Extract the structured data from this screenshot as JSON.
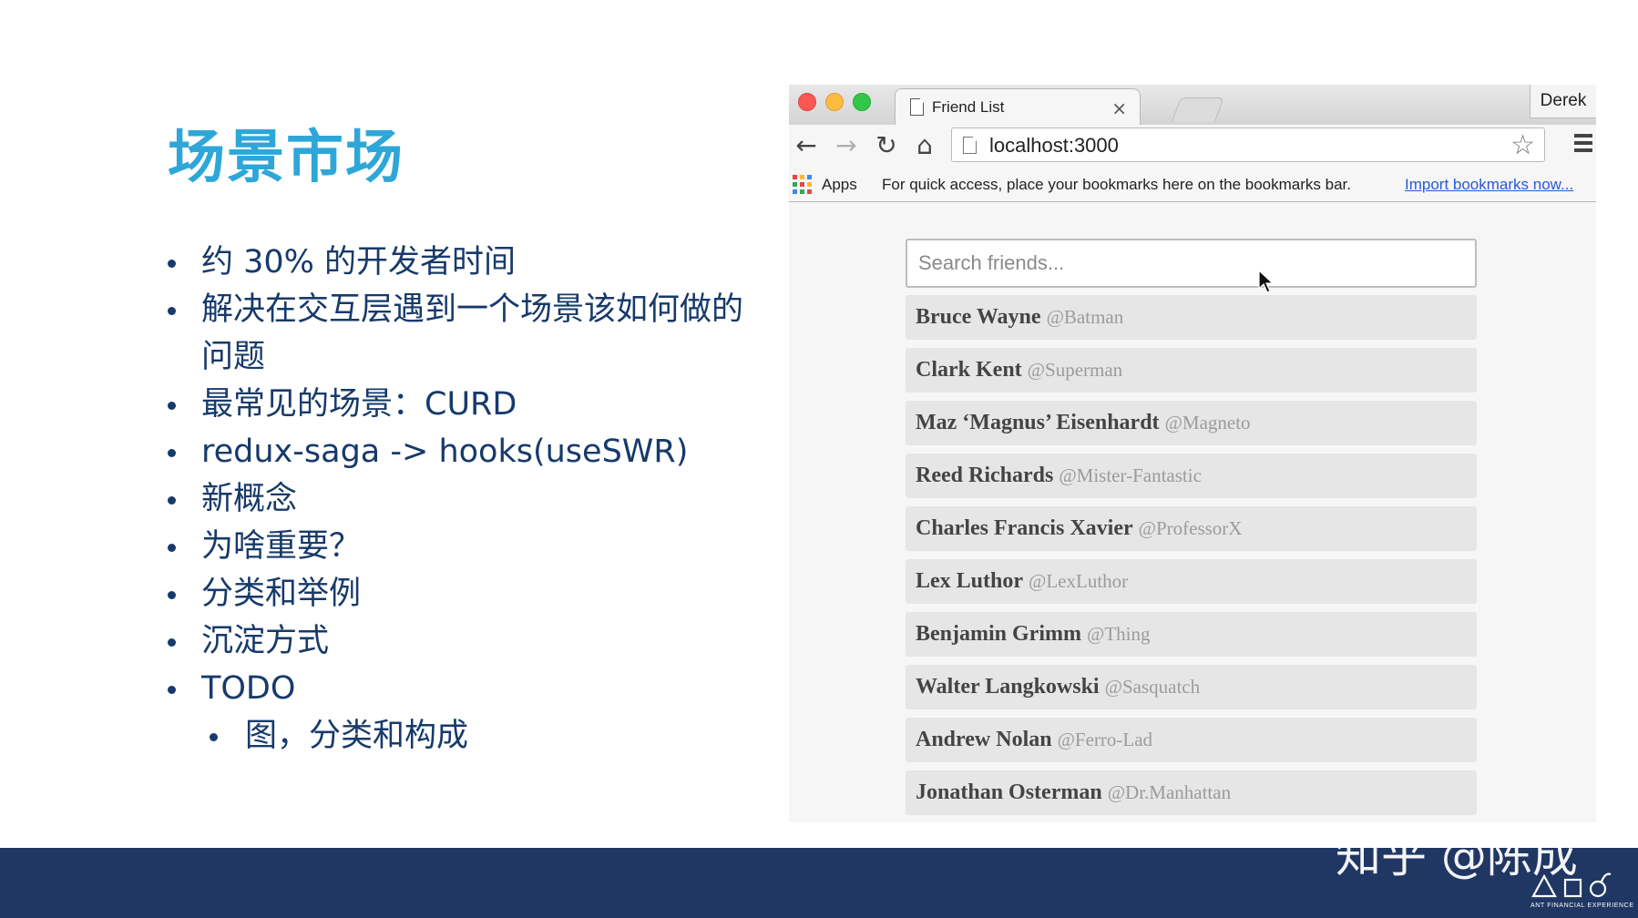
{
  "slide": {
    "title": "场景市场",
    "bullets": [
      "约 30% 的开发者时间",
      "解决在交互层遇到一个场景该如何做的问题",
      "最常见的场景：CURD",
      "redux-saga -> hooks(useSWR)",
      "新概念",
      "为啥重要？",
      "分类和举例",
      "沉淀方式",
      "TODO"
    ],
    "sub_bullets": [
      "图，分类和构成"
    ]
  },
  "browser": {
    "tab_title": "Friend List",
    "tab_close": "×",
    "profile_name": "Derek",
    "url": "localhost:3000",
    "icons": [
      "back-icon",
      "forward-icon",
      "reload-icon",
      "home-icon",
      "page-icon",
      "star-icon",
      "menu-icon",
      "apps-icon",
      "mouse-cursor-icon"
    ],
    "bookmarks": {
      "apps_label": "Apps",
      "hint": "For quick access, place your bookmarks here on the bookmarks bar.",
      "import_link": "Import bookmarks now..."
    },
    "app": {
      "search_placeholder": "Search friends...",
      "friends": [
        {
          "name": "Bruce Wayne",
          "handle": "@Batman"
        },
        {
          "name": "Clark Kent",
          "handle": "@Superman"
        },
        {
          "name": "Maz ‘Magnus’ Eisenhardt",
          "handle": "@Magneto"
        },
        {
          "name": "Reed Richards",
          "handle": "@Mister-Fantastic"
        },
        {
          "name": "Charles Francis Xavier",
          "handle": "@ProfessorX"
        },
        {
          "name": "Lex Luthor",
          "handle": "@LexLuthor"
        },
        {
          "name": "Benjamin Grimm",
          "handle": "@Thing"
        },
        {
          "name": "Walter Langkowski",
          "handle": "@Sasquatch"
        },
        {
          "name": "Andrew Nolan",
          "handle": "@Ferro-Lad"
        },
        {
          "name": "Jonathan Osterman",
          "handle": "@Dr.Manhattan"
        }
      ]
    }
  },
  "footer": {
    "watermark": "知乎 @陈成",
    "brand_text": "ANT FINANCIAL EXPERIENCE"
  },
  "colors": {
    "title": "#2ea7d8",
    "text": "#173a6b",
    "footer_bg": "#203764",
    "link": "#1f5fcf"
  }
}
